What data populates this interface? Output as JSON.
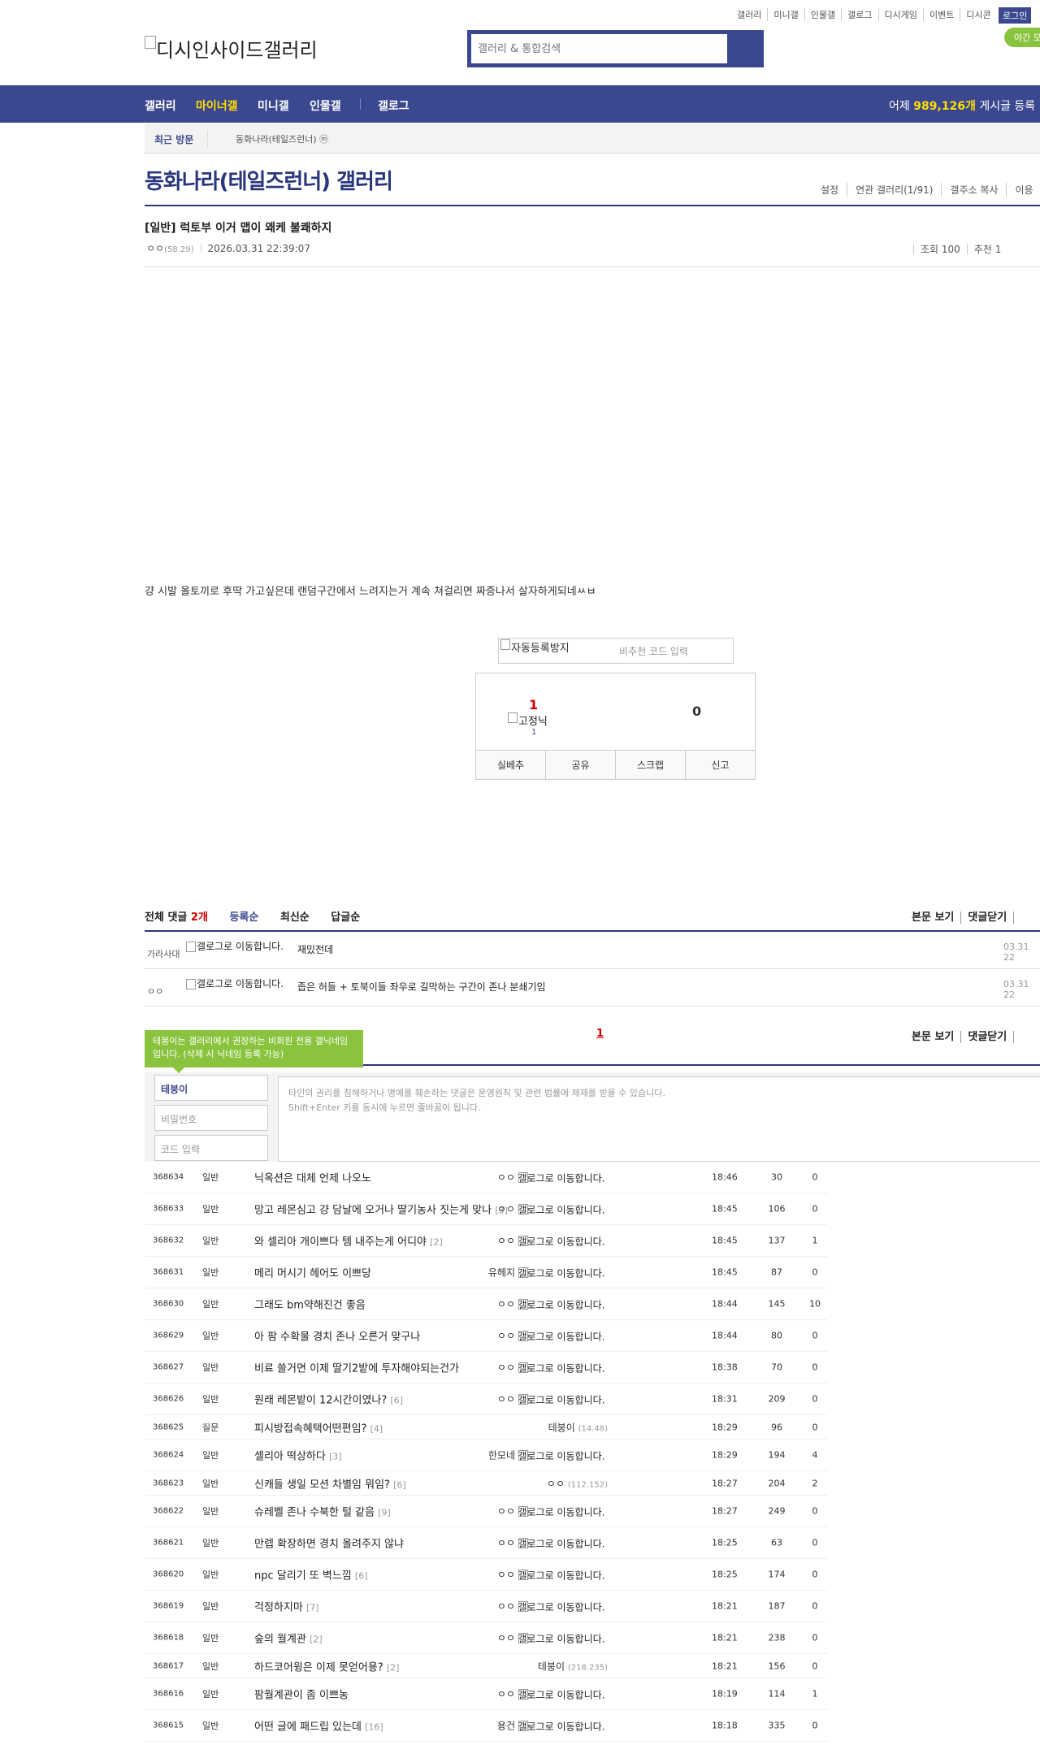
{
  "top_links": [
    "갤러리",
    "미니갤",
    "인물갤",
    "갤로그",
    "디시게임",
    "이벤트",
    "디시콘"
  ],
  "login": "로그인",
  "night_mode": "야간 모드",
  "logo": "디시인사이드갤러리",
  "search": {
    "placeholder": "갤러리 & 통합검색"
  },
  "nav": {
    "items": [
      "갤러리",
      "마이너갤",
      "미니갤",
      "인물갤",
      "갤로그"
    ],
    "right_prefix": "어제",
    "right_count": "989,126개",
    "right_suffix": "게시글 등록"
  },
  "recent": {
    "label": "최근 방문",
    "item": "동화나라(테일즈런너) ⓜ"
  },
  "gallery": {
    "title": "동화나라(테일즈런너) 갤러리",
    "options": [
      "설정",
      "연관 갤러리(1/91)",
      "갤주소 복사",
      "이용"
    ]
  },
  "post": {
    "title": "[일반] 럭토부 이거 맵이 왜케 불쾌하지",
    "author": "ㅇㅇ",
    "ip": "(58.29)",
    "datetime": "2026.03.31 22:39:07",
    "views": "조회 100",
    "recs": "추천 1",
    "body": "걍 시발 올토끼로 후딱 가고싶은데 랜덤구간에서 느려지는거 계속 쳐걸리면 짜증나서 살자하게되네ㅆㅂ"
  },
  "captcha": {
    "img_alt": "자동등록방지",
    "placeholder": "비추천 코드 입력"
  },
  "recommend": {
    "up": "1",
    "fixed_alt": "고정닉",
    "fixed_count": "1",
    "down": "0",
    "buttons": [
      "실베추",
      "공유",
      "스크랩",
      "신고"
    ]
  },
  "comments": {
    "header_prefix": "전체 댓글",
    "count": "2개",
    "sorts": [
      "등록순",
      "최신순",
      "답글순"
    ],
    "right": [
      "본문 보기",
      "댓글닫기"
    ],
    "gallog_alt": "갤로그로 이동합니다.",
    "items": [
      {
        "nick": "가라사대",
        "text": "재밌전데",
        "date": "03.31 22"
      },
      {
        "nick": "ㅇㅇ",
        "text": "좁은 허들 + 토북이들 좌우로 길막하는 구간이 존나 분쇄기임",
        "date": "03.31 22"
      }
    ],
    "page": "1"
  },
  "tooltip": "테붕이는 갤러리에서 권장하는 비회원 전용 갤닉네임입니다. (삭제 시 닉네임 등록 가능)",
  "form": {
    "nick": "테붕이",
    "password": "비밀번호",
    "code": "코드 입력",
    "notice1": "타인의 권리를 침해하거나 명예를 훼손하는 댓글은 운영원칙 및 관련 법률에 제재를 받을 수 있습니다.",
    "notice2": "Shift+Enter 키를 동시에 누르면 줄바꿈이 됩니다."
  },
  "posts": [
    {
      "num": "368634",
      "sub": "일반",
      "title": "닉옥션은 대체 언제 나오노",
      "rc": "",
      "nick": "ㅇㅇ",
      "gallog": true,
      "ip": "",
      "date": "18:46",
      "view": "30",
      "rec": "0"
    },
    {
      "num": "368633",
      "sub": "일반",
      "title": "망고 레몬심고 걍 담날에 오거나 딸기농사 짓는게 맞나",
      "rc": "[3]",
      "nick": "ㅇㅇ",
      "gallog": true,
      "ip": "",
      "date": "18:45",
      "view": "106",
      "rec": "0"
    },
    {
      "num": "368632",
      "sub": "일반",
      "title": "와 셀리아 개이쁘다 템 내주는게 어디야",
      "rc": "[2]",
      "nick": "ㅇㅇ",
      "gallog": true,
      "ip": "",
      "date": "18:45",
      "view": "137",
      "rec": "1"
    },
    {
      "num": "368631",
      "sub": "일반",
      "title": "메리 머시기 헤어도 이쁘당",
      "rc": "",
      "nick": "유헤지",
      "gallog": true,
      "ip": "",
      "date": "18:45",
      "view": "87",
      "rec": "0"
    },
    {
      "num": "368630",
      "sub": "일반",
      "title": "그래도 bm약해진건 좋음",
      "rc": "",
      "nick": "ㅇㅇ",
      "gallog": true,
      "ip": "",
      "date": "18:44",
      "view": "145",
      "rec": "10"
    },
    {
      "num": "368629",
      "sub": "일반",
      "title": "아 팜 수확물 경치 존나 오른거 맞구나",
      "rc": "",
      "nick": "ㅇㅇ",
      "gallog": true,
      "ip": "",
      "date": "18:44",
      "view": "80",
      "rec": "0"
    },
    {
      "num": "368627",
      "sub": "일반",
      "title": "비료 쓸거면 이제 딸기2밭에 투자해야되는건가",
      "rc": "",
      "nick": "ㅇㅇ",
      "gallog": true,
      "ip": "",
      "date": "18:38",
      "view": "70",
      "rec": "0"
    },
    {
      "num": "368626",
      "sub": "일반",
      "title": "원래 레몬밭이 12시간이였나?",
      "rc": "[6]",
      "nick": "ㅇㅇ",
      "gallog": true,
      "ip": "",
      "date": "18:31",
      "view": "209",
      "rec": "0"
    },
    {
      "num": "368625",
      "sub": "질문",
      "title": "피시방접속혜택어떤편임?",
      "rc": "[4]",
      "nick": "테붕이",
      "gallog": false,
      "ip": "(14.48)",
      "date": "18:29",
      "view": "96",
      "rec": "0"
    },
    {
      "num": "368624",
      "sub": "일반",
      "title": "셀리아 떡상하다",
      "rc": "[3]",
      "nick": "한모네",
      "gallog": true,
      "ip": "",
      "date": "18:29",
      "view": "194",
      "rec": "4"
    },
    {
      "num": "368623",
      "sub": "일반",
      "title": "신캐들 생일 모션 차별임 뭐임?",
      "rc": "[6]",
      "nick": "ㅇㅇ",
      "gallog": false,
      "ip": "(112.152)",
      "date": "18:27",
      "view": "204",
      "rec": "2"
    },
    {
      "num": "368622",
      "sub": "일반",
      "title": "슈레벨 존나 수북한 털 같음",
      "rc": "[9]",
      "nick": "ㅇㅇ",
      "gallog": true,
      "ip": "",
      "date": "18:27",
      "view": "249",
      "rec": "0"
    },
    {
      "num": "368621",
      "sub": "일반",
      "title": "만렙 확장하면 경치 올려주지 않냐",
      "rc": "",
      "nick": "ㅇㅇ",
      "gallog": true,
      "ip": "",
      "date": "18:25",
      "view": "63",
      "rec": "0"
    },
    {
      "num": "368620",
      "sub": "일반",
      "title": "npc 달리기 또 벽느낌",
      "rc": "[6]",
      "nick": "ㅇㅇ",
      "gallog": true,
      "ip": "",
      "date": "18:25",
      "view": "174",
      "rec": "0"
    },
    {
      "num": "368619",
      "sub": "일반",
      "title": "걱정하지마",
      "rc": "[7]",
      "nick": "ㅇㅇ",
      "gallog": true,
      "ip": "",
      "date": "18:21",
      "view": "187",
      "rec": "0"
    },
    {
      "num": "368618",
      "sub": "일반",
      "title": "숲의 월계관",
      "rc": "[2]",
      "nick": "ㅇㅇ",
      "gallog": true,
      "ip": "",
      "date": "18:21",
      "view": "238",
      "rec": "0"
    },
    {
      "num": "368617",
      "sub": "일반",
      "title": "하드코어윙은 이제 못얻어용?",
      "rc": "[2]",
      "nick": "테붕이",
      "gallog": false,
      "ip": "(218.235)",
      "date": "18:21",
      "view": "156",
      "rec": "0"
    },
    {
      "num": "368616",
      "sub": "일반",
      "title": "팜월계관이 좀 이쁘농",
      "rc": "",
      "nick": "ㅇㅇ",
      "gallog": true,
      "ip": "",
      "date": "18:19",
      "view": "114",
      "rec": "1"
    },
    {
      "num": "368615",
      "sub": "일반",
      "title": "어떤 글에 패드립 있는데",
      "rc": "[16]",
      "nick": "용건",
      "gallog": true,
      "ip": "",
      "date": "18:18",
      "view": "335",
      "rec": "0"
    }
  ]
}
